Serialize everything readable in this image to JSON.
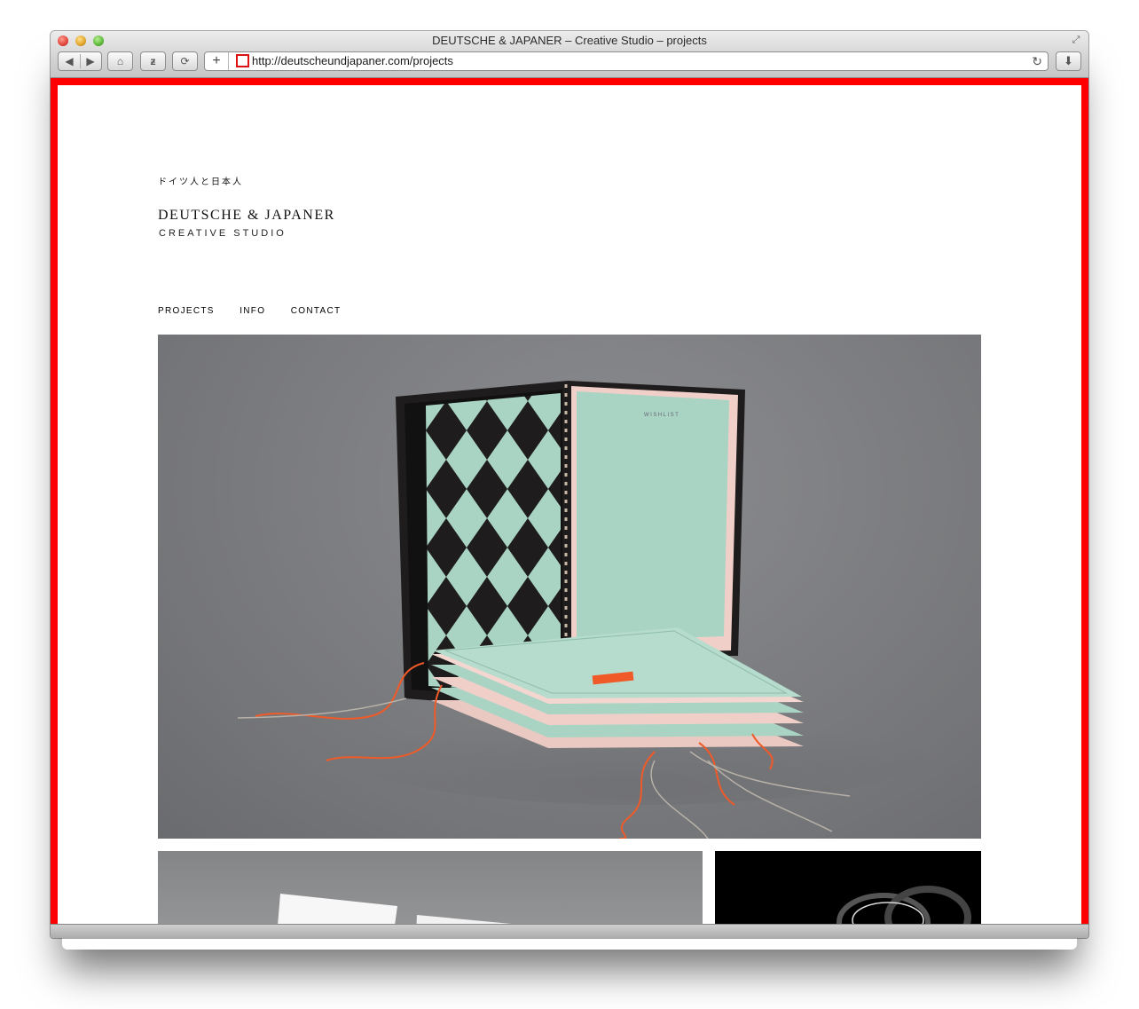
{
  "window": {
    "title": "DEUTSCHE & JAPANER – Creative Studio – projects"
  },
  "toolbar": {
    "back_icon": "◀",
    "forward_icon": "▶",
    "home_icon": "⌂",
    "z_icon": "ƶ",
    "sync_icon": "⟳",
    "plus_icon": "+",
    "reload_icon": "↻",
    "download_icon": "⬇"
  },
  "address_bar": {
    "url": "http://deutscheundjapaner.com/projects"
  },
  "site": {
    "japanese_name": "ドイツ人と日本人",
    "name": "DEUTSCHE & JAPANER",
    "subtitle": "CREATIVE STUDIO",
    "nav": [
      "PROJECTS",
      "INFO",
      "CONTACT"
    ],
    "hero_booklet_label": "WISHLIST"
  },
  "colors": {
    "page_frame": "#ff0000",
    "photo_background": "#7d7e81",
    "mint": "#a9d4c4",
    "thread_orange": "#f05a28"
  }
}
